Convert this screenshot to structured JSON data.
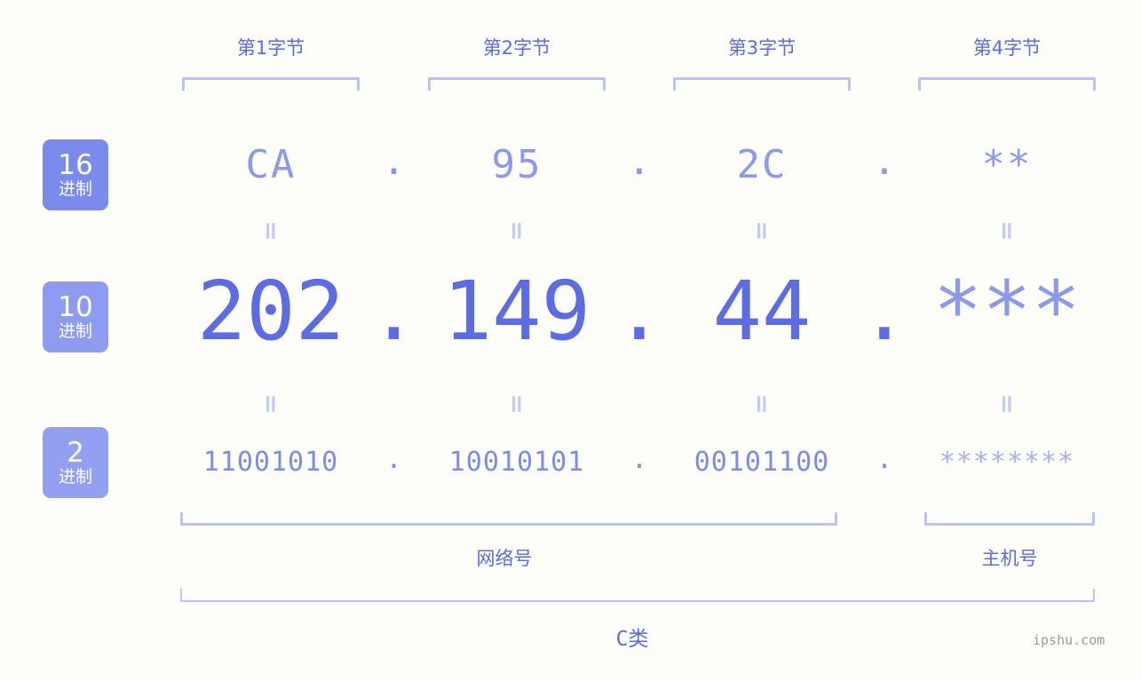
{
  "meta": {
    "watermark": "ipshu.com"
  },
  "byte_headers": [
    {
      "label": "第1字节"
    },
    {
      "label": "第2字节"
    },
    {
      "label": "第3字节"
    },
    {
      "label": "第4字节"
    }
  ],
  "bases": [
    {
      "num": "16",
      "suffix": "进制",
      "color": "#7b8aed"
    },
    {
      "num": "10",
      "suffix": "进制",
      "color": "#8e9bf0"
    },
    {
      "num": "2",
      "suffix": "进制",
      "color": "#93a0f2"
    }
  ],
  "separators": {
    "dot": ".",
    "equals": "="
  },
  "rows": {
    "hex": {
      "octets": [
        "CA",
        "95",
        "2C",
        "**"
      ],
      "masked_index": 3
    },
    "decimal": {
      "octets": [
        "202",
        "149",
        "44",
        "***"
      ],
      "masked_index": 3
    },
    "binary": {
      "octets": [
        "11001010",
        "10010101",
        "00101100",
        "********"
      ],
      "masked_index": 3
    }
  },
  "sections": {
    "network": "网络号",
    "host": "主机号",
    "class": "C类"
  }
}
